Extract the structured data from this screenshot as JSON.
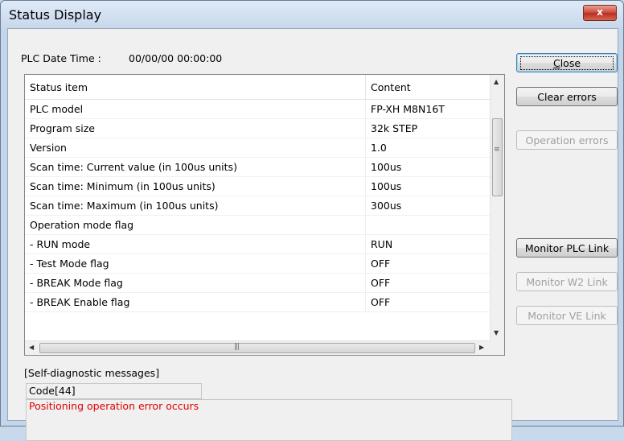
{
  "window": {
    "title": "Status Display",
    "close_glyph": "x"
  },
  "datetime": {
    "label": "PLC Date Time :",
    "value": "00/00/00 00:00:00"
  },
  "grid": {
    "headers": [
      "Status item",
      "Content"
    ],
    "rows": [
      [
        "PLC model",
        "FP-XH M8N16T"
      ],
      [
        "Program size",
        "32k STEP"
      ],
      [
        "Version",
        "1.0"
      ],
      [
        "Scan time: Current value (in 100us units)",
        "100us"
      ],
      [
        "Scan time: Minimum (in 100us units)",
        "100us"
      ],
      [
        "Scan time: Maximum (in 100us units)",
        "300us"
      ],
      [
        "Operation mode flag",
        ""
      ],
      [
        "- RUN mode",
        "RUN"
      ],
      [
        "- Test Mode flag",
        "OFF"
      ],
      [
        "- BREAK Mode flag",
        "OFF"
      ],
      [
        "- BREAK Enable flag",
        "OFF"
      ]
    ]
  },
  "buttons": {
    "close": "Close",
    "clear_errors": "Clear errors",
    "operation_errors": "Operation errors",
    "monitor_plc_link": "Monitor PLC Link",
    "monitor_w2_link": "Monitor W2 Link",
    "monitor_ve_link": "Monitor VE Link"
  },
  "diagnostics": {
    "label": "[Self-diagnostic messages]",
    "code": "Code[44]",
    "message": "Positioning operation error occurs",
    "message_color": "#e00000"
  },
  "icons": [
    "close-window-icon",
    "scroll-up-arrow-icon",
    "scroll-down-arrow-icon",
    "scroll-left-arrow-icon",
    "scroll-right-arrow-icon"
  ]
}
